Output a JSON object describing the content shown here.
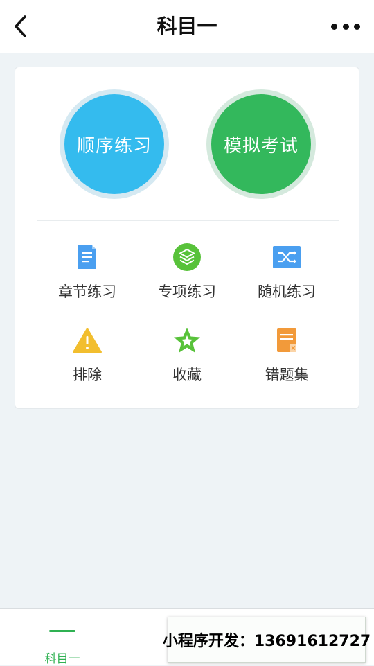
{
  "nav": {
    "title": "科目一",
    "back_icon": "chevron-left-icon",
    "more_icon": "more-dots-icon"
  },
  "primary": {
    "sequential": "顺序练习",
    "mock_exam": "模拟考试"
  },
  "grid": {
    "items": [
      {
        "label": "章节练习",
        "icon": "document-icon",
        "color": "#4a9ff0"
      },
      {
        "label": "专项练习",
        "icon": "layers-icon",
        "color": "#58c23a"
      },
      {
        "label": "随机练习",
        "icon": "shuffle-icon",
        "color": "#4a9ff0"
      },
      {
        "label": "排除",
        "icon": "warning-icon",
        "color": "#f2be2e"
      },
      {
        "label": "收藏",
        "icon": "star-icon",
        "color": "#58c23a"
      },
      {
        "label": "错题集",
        "icon": "error-note-icon",
        "color": "#f29a3a"
      }
    ]
  },
  "tabbar": {
    "active_label": "科目一",
    "accent": "#2fb152"
  },
  "promo": {
    "text": "小程序开发：13691612727"
  }
}
